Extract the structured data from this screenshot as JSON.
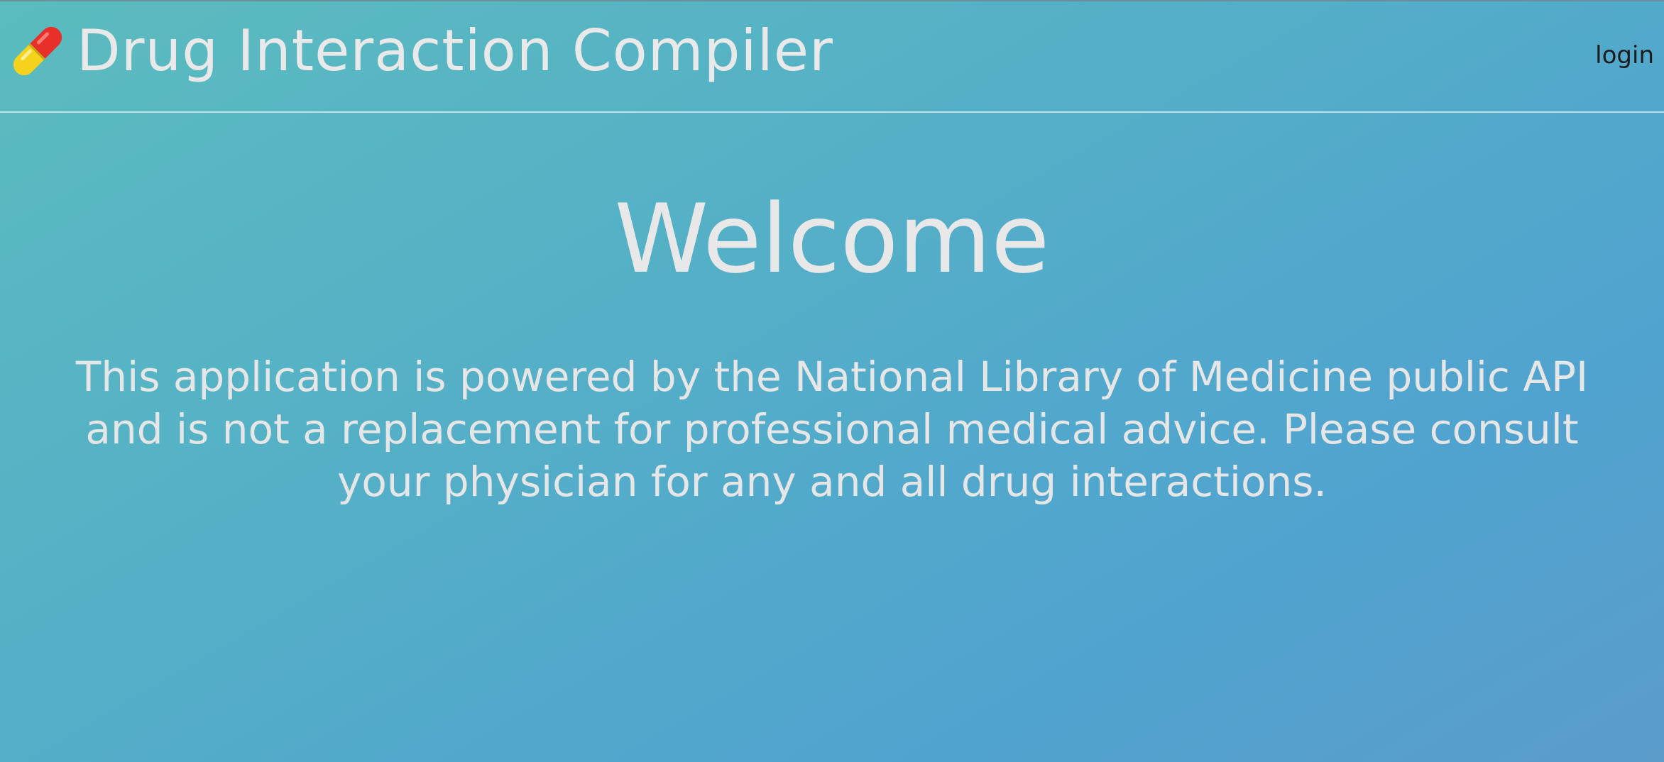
{
  "header": {
    "title": "Drug Interaction Compiler",
    "icon": "pill-icon",
    "login_label": "login"
  },
  "main": {
    "heading": "Welcome",
    "disclaimer": "This application is powered by the National Library of Medicine public API and is not a replacement for professional medical advice. Please consult your physician for any and all drug interactions."
  },
  "colors": {
    "background_start": "#5bbcbe",
    "background_end": "#5b9ccb",
    "text": "#e8e8e8",
    "login_text": "#1c1c1c",
    "pill_red": "#e8302a",
    "pill_yellow": "#f5d21c"
  }
}
